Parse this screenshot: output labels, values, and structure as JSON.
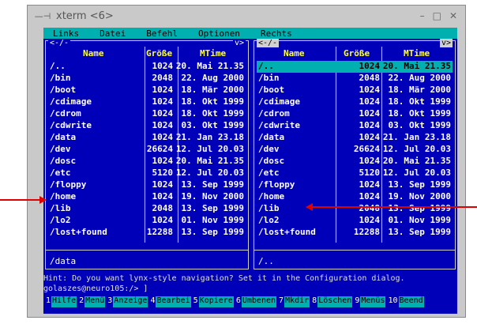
{
  "window": {
    "title": "xterm <6>",
    "sysmenu": "—⊣",
    "buttons": [
      "–",
      "□",
      "✕"
    ]
  },
  "menubar": [
    "Links",
    "Datei",
    "Befehl",
    "Optionen",
    "Rechts"
  ],
  "left_panel": {
    "top_left": "<-/-",
    "top_right": "v>",
    "headers": [
      "Name",
      "Größe",
      "MTime"
    ],
    "rows": [
      [
        "/..",
        "1024",
        "20. Mai 21.35"
      ],
      [
        "/bin",
        "2048",
        "22. Aug 2000"
      ],
      [
        "/boot",
        "1024",
        "18. Mär 2000"
      ],
      [
        "/cdimage",
        "1024",
        "18. Okt 1999"
      ],
      [
        "/cdrom",
        "1024",
        "18. Okt 1999"
      ],
      [
        "/cdwrite",
        "1024",
        "03. Okt 1999"
      ],
      [
        "/data",
        "1024",
        "21. Jan 23.18"
      ],
      [
        "/dev",
        "26624",
        "12. Jul 20.03"
      ],
      [
        "/dosc",
        "1024",
        "20. Mai 21.35"
      ],
      [
        "/etc",
        "5120",
        "12. Jul 20.03"
      ],
      [
        "/floppy",
        "1024",
        "13. Sep 1999"
      ],
      [
        "/home",
        "1024",
        "19. Nov 2000"
      ],
      [
        "/lib",
        "2048",
        "13. Sep 1999"
      ],
      [
        "/lo2",
        "1024",
        "01. Nov 1999"
      ],
      [
        "/lost+found",
        "12288",
        "13. Sep 1999"
      ]
    ],
    "footer": "/data"
  },
  "right_panel": {
    "top_left": "<-/-",
    "top_right": "v>",
    "headers": [
      "Name",
      "Größe",
      "MTime"
    ],
    "selected_index": 0,
    "rows": [
      [
        "/..",
        "1024",
        "20. Mai 21.35"
      ],
      [
        "/bin",
        "2048",
        "22. Aug 2000"
      ],
      [
        "/boot",
        "1024",
        "18. Mär 2000"
      ],
      [
        "/cdimage",
        "1024",
        "18. Okt 1999"
      ],
      [
        "/cdrom",
        "1024",
        "18. Okt 1999"
      ],
      [
        "/cdwrite",
        "1024",
        "03. Okt 1999"
      ],
      [
        "/data",
        "1024",
        "21. Jan 23.18"
      ],
      [
        "/dev",
        "26624",
        "12. Jul 20.03"
      ],
      [
        "/dosc",
        "1024",
        "20. Mai 21.35"
      ],
      [
        "/etc",
        "5120",
        "12. Jul 20.03"
      ],
      [
        "/floppy",
        "1024",
        "13. Sep 1999"
      ],
      [
        "/home",
        "1024",
        "19. Nov 2000"
      ],
      [
        "/lib",
        "2048",
        "13. Sep 1999"
      ],
      [
        "/lo2",
        "1024",
        "01. Nov 1999"
      ],
      [
        "/lost+found",
        "12288",
        "13. Sep 1999"
      ]
    ],
    "footer": "/.."
  },
  "hint": "Hint: Do you want lynx-style navigation? Set it in the Configuration dialog.",
  "prompt": "golaszes@neuro105:/> ]",
  "fkeys": [
    {
      "n": "1",
      "l": "Hilfe"
    },
    {
      "n": "2",
      "l": "Menü"
    },
    {
      "n": "3",
      "l": "Anzeige"
    },
    {
      "n": "4",
      "l": "Bearbei"
    },
    {
      "n": "5",
      "l": "Kopiere"
    },
    {
      "n": "6",
      "l": "Umbenen"
    },
    {
      "n": "7",
      "l": "Mkdir"
    },
    {
      "n": "8",
      "l": "Löschen"
    },
    {
      "n": "9",
      "l": "Menüs"
    },
    {
      "n": "10",
      "l": "Beend"
    }
  ],
  "colors": {
    "terminal_bg": "#0000b8",
    "accent_cyan": "#00b0b0",
    "header_yellow": "#ffff40",
    "annotation_arrow": "#e00000"
  }
}
